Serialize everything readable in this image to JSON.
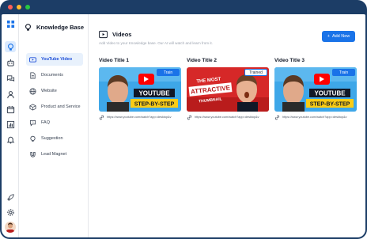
{
  "colors": {
    "frame": "#1c3d66",
    "accent": "#1a73e8",
    "active_bg": "#e8f1fc"
  },
  "rail": {
    "icons": [
      "grid-icon",
      "lightbulb-icon",
      "bot-icon",
      "chat-icon",
      "person-icon",
      "calendar-icon",
      "bar-chart-icon",
      "bell-icon",
      "rocket-icon",
      "gear-icon"
    ]
  },
  "sidebar": {
    "title": "Knowledge Base",
    "items": [
      {
        "label": "YouTube Video",
        "icon": "youtube-icon",
        "active": true
      },
      {
        "label": "Documents",
        "icon": "document-icon",
        "active": false
      },
      {
        "label": "Website",
        "icon": "globe-icon",
        "active": false
      },
      {
        "label": "Product and Service",
        "icon": "package-icon",
        "active": false
      },
      {
        "label": "FAQ",
        "icon": "help-icon",
        "active": false
      },
      {
        "label": "Suggestion",
        "icon": "suggestion-icon",
        "active": false
      },
      {
        "label": "Lead Magnet",
        "icon": "magnet-icon",
        "active": false
      }
    ]
  },
  "main": {
    "title": "Videos",
    "subtitle": "Add Video to your Knowledge base. Our AI will watch and learn from it.",
    "add_button": "Add New",
    "videos": [
      {
        "title": "Video Title 1",
        "url": "https://www.youtube.com/watch?app=desktop&v",
        "action": "Train",
        "thumb_text_1": "YOUTUBE",
        "thumb_text_2": "STEP-BY-STEP",
        "theme": "blue"
      },
      {
        "title": "Video Title 2",
        "url": "https://www.youtube.com/watch?app=desktop&v",
        "action": "Trained",
        "thumb_text_1": "THE MOST",
        "thumb_text_2": "ATTRACTIVE",
        "thumb_text_3": "THUMBNAIL",
        "theme": "red"
      },
      {
        "title": "Video Title 3",
        "url": "https://www.youtube.com/watch?app=desktop&v",
        "action": "Train",
        "thumb_text_1": "YOUTUBE",
        "thumb_text_2": "STEP-BY-STEP",
        "theme": "blue"
      }
    ]
  }
}
